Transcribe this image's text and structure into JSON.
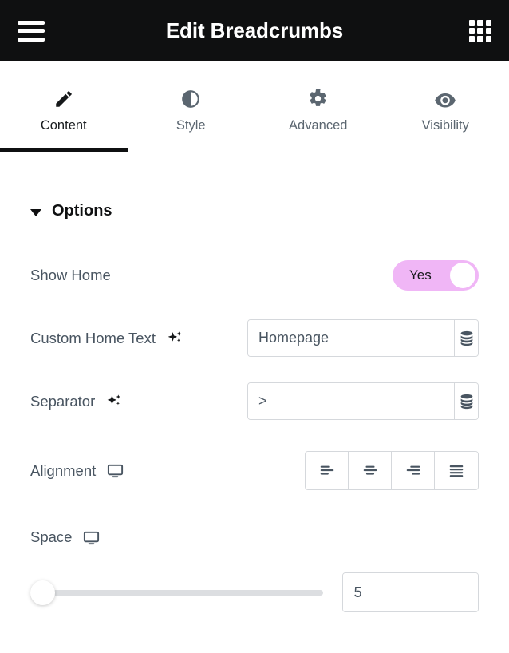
{
  "header": {
    "title": "Edit Breadcrumbs",
    "menu_icon": "hamburger-icon",
    "apps_icon": "grid-apps-icon",
    "background": "#0f1011"
  },
  "tabs": [
    {
      "label": "Content",
      "icon": "pencil-icon",
      "active": true
    },
    {
      "label": "Style",
      "icon": "contrast-icon",
      "active": false
    },
    {
      "label": "Advanced",
      "icon": "gear-icon",
      "active": false
    },
    {
      "label": "Visibility",
      "icon": "eye-icon",
      "active": false
    }
  ],
  "section": {
    "title": "Options",
    "expanded": true,
    "caret_icon": "chevron-down-icon"
  },
  "controls": {
    "show_home": {
      "label": "Show Home",
      "toggle_value": "Yes",
      "toggle_on": true,
      "toggle_color": "#f0b6f6"
    },
    "custom_home_text": {
      "label": "Custom Home Text",
      "ai_icon": "sparkles-icon",
      "value": "Homepage",
      "placeholder": "Homepage",
      "dynamic_icon": "database-icon"
    },
    "separator": {
      "label": "Separator",
      "ai_icon": "sparkles-icon",
      "value": ">",
      "placeholder": ">",
      "dynamic_icon": "database-icon"
    },
    "alignment": {
      "label": "Alignment",
      "device_icon": "desktop-icon",
      "options": [
        {
          "name": "align-left",
          "icon": "align-left-icon",
          "selected": false
        },
        {
          "name": "align-center",
          "icon": "align-center-icon",
          "selected": false
        },
        {
          "name": "align-right",
          "icon": "align-right-icon",
          "selected": false
        },
        {
          "name": "align-justify",
          "icon": "align-justify-icon",
          "selected": false
        }
      ]
    },
    "space": {
      "label": "Space",
      "device_icon": "desktop-icon",
      "slider_value": 0,
      "value": "5",
      "dynamic_icon": "database-icon"
    }
  }
}
